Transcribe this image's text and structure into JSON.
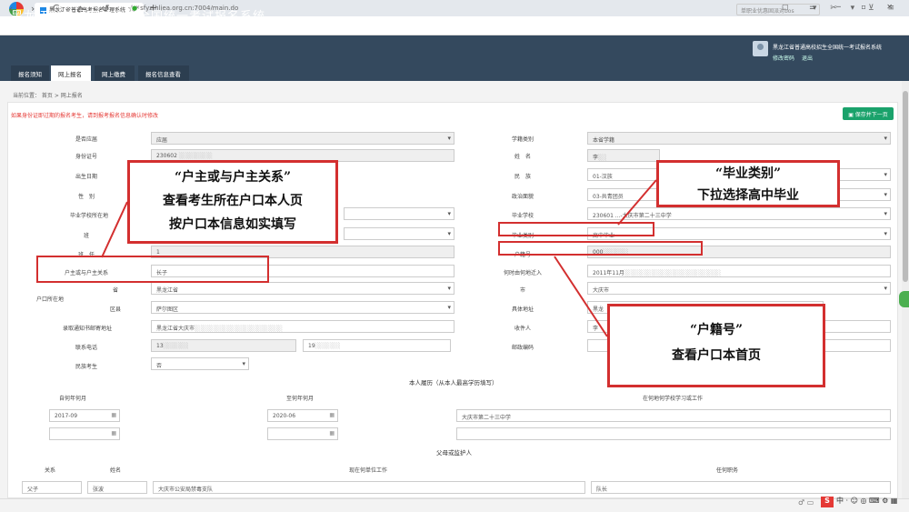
{
  "browser": {
    "tab_title": "黑龙江省普通高考报名管理系统",
    "tab_close": "×",
    "new_tab": "+",
    "window_controls": "▢ ☰ ─ ▫ ✕",
    "nav_buttons": "‹ › C ⌂ ↺ ☆",
    "url": "sfyz.hljea.org.cn:7004/main.do",
    "search_placeholder": "单职业优惠固派对bos",
    "right_tools": "▾ ✂ ▾ ⊻ ≡"
  },
  "app": {
    "title": "黑龙江省普通高校招生全国统一考试报名系统",
    "user_name": "黑龙江省普通高校招生全国统一考试报名系统",
    "link_change_pwd": "修改密码",
    "link_logout": "退出",
    "tabs": [
      {
        "label": "报名须知"
      },
      {
        "label": "网上报名"
      },
      {
        "label": "网上缴费"
      },
      {
        "label": "报名信息查看"
      }
    ]
  },
  "breadcrumb": "当前位置： 首页 > 网上报名",
  "notice": "如果身份证即过期的报名考生，请到报考报名信息确认时修改",
  "save_button": "保存并下一页",
  "left_form": {
    "shifouyingjie_label": "是否应届",
    "shifouyingjie_value": "应届",
    "idcard_label": "身份证号",
    "idcard_value": "230602",
    "birth_label": "出生日期",
    "gender_label": "性　别",
    "gradschool_region_label": "毕业学校所在地",
    "ban_label": "班",
    "banzhuren_label": "班　任",
    "banzhuren_value": "1",
    "relation_label": "户主或与户主关系",
    "relation_value": "长子",
    "huji_group_label": "户口所在地",
    "province_label": "省",
    "province_value": "黑龙江省",
    "district_label": "区县",
    "district_value": "萨尔图区",
    "mail_addr_label": "录取通知书邮寄地址",
    "mail_addr_value": "黑龙江省大庆市",
    "phone_label": "联系电话",
    "phone_value_1": "13",
    "phone_value_2": "19",
    "ethnic_exam_label": "民族考生",
    "ethnic_exam_value": "否"
  },
  "right_form": {
    "xueji_label": "学籍类别",
    "xueji_value": "本省学籍",
    "name_label": "姓　名",
    "name_value": "李",
    "minzu_label": "民　族",
    "minzu_value": "01-汉族",
    "zhengzhi_label": "政治面貌",
    "zhengzhi_value": "03-共青团员",
    "gradschool_label": "毕业学校",
    "gradschool_value": "230601 ...-大庆市第二十三中学",
    "gradtype_label": "毕业类别",
    "gradtype_value": "高中毕业",
    "hujihao_label": "户籍号",
    "hujihao_value": "000",
    "time_label": "何时由何地迁入",
    "time_value": "2011年11月",
    "city_label": "市",
    "city_value": "大庆市",
    "address_label": "具体地址",
    "address_value": "黑龙",
    "receiver_label": "收件人",
    "receiver_value": "李",
    "postcode_label": "邮政编码"
  },
  "resume": {
    "title": "本人履历（从本人最高学历填写）",
    "col_from": "自何年何月",
    "col_to": "至何年何月",
    "col_where": "在何地何学校学习或工作",
    "row1_from": "2017-09",
    "row1_to": "2020-06",
    "row1_where": "大庆市第二十三中学"
  },
  "guardians": {
    "title": "父母或监护人",
    "col_relation": "关系",
    "col_name": "姓名",
    "col_work": "现在何单位工作",
    "col_position": "任何职务",
    "row1_relation": "父子",
    "row1_name": "张波",
    "row1_work": "大庆市公安局禁毒支队",
    "row1_position": "队长"
  },
  "annotations": {
    "a1_line1": "“户主或与户主关系”",
    "a1_line2": "查看考生所在户口本人页",
    "a1_line3": "按户口本信息如实填写",
    "a2_line1": "“毕业类别”",
    "a2_line2": "下拉选择高中毕业",
    "a3_line1": "“户籍号”",
    "a3_line2": "查看户口本首页"
  },
  "taskbar": {
    "ime": "中 · ☺ ◎ ⌨ ⚙ ▦",
    "ime_logo": "S",
    "tray": "♂ ▭"
  },
  "colors": {
    "header_bg": "#34495e",
    "accent_red": "#d32f2f",
    "save_green": "#1aa26b"
  }
}
